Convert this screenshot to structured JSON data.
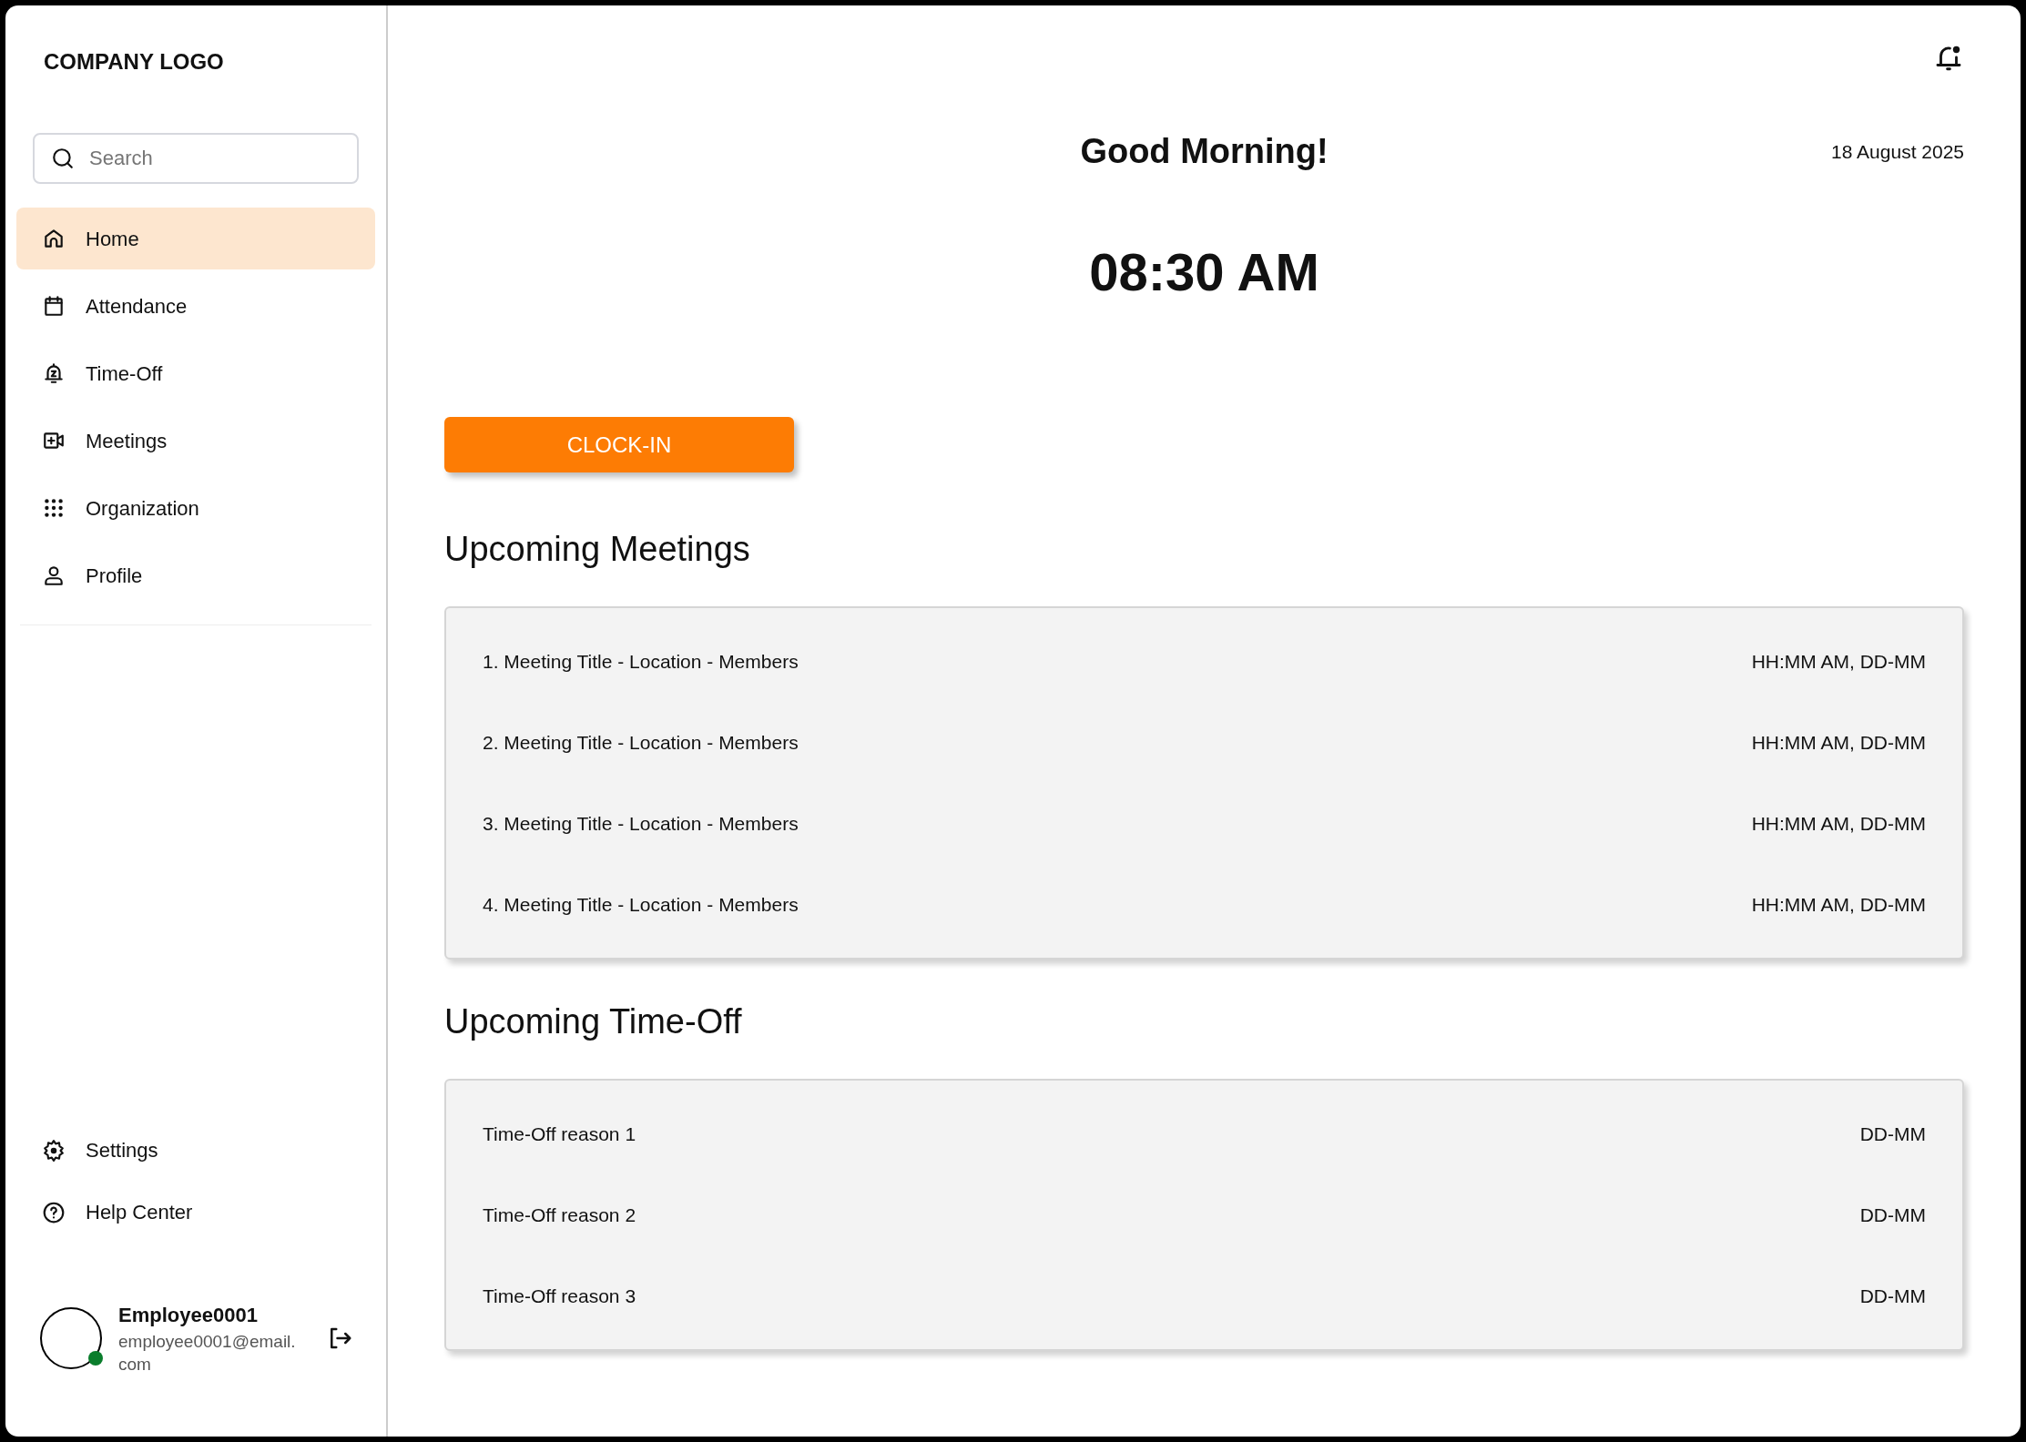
{
  "sidebar": {
    "logo": "COMPANY LOGO",
    "search": {
      "placeholder": "Search"
    },
    "nav": [
      {
        "label": "Home",
        "selected": true
      },
      {
        "label": "Attendance",
        "selected": false
      },
      {
        "label": "Time-Off",
        "selected": false
      },
      {
        "label": "Meetings",
        "selected": false
      },
      {
        "label": "Organization",
        "selected": false
      },
      {
        "label": "Profile",
        "selected": false
      }
    ],
    "footer_nav": [
      {
        "label": "Settings"
      },
      {
        "label": "Help Center"
      }
    ],
    "user": {
      "name": "Employee0001",
      "email": "employee0001@email.com",
      "online": true
    }
  },
  "header": {
    "greeting": "Good Morning!",
    "date": "18 August 2025",
    "time": "08:30 AM"
  },
  "clock_button": "CLOCK-IN",
  "meetings": {
    "title": "Upcoming Meetings",
    "items": [
      {
        "text": "1. Meeting Title - Location - Members",
        "when": "HH:MM AM, DD-MM"
      },
      {
        "text": "2. Meeting Title - Location - Members",
        "when": "HH:MM AM, DD-MM"
      },
      {
        "text": "3. Meeting Title - Location - Members",
        "when": "HH:MM AM, DD-MM"
      },
      {
        "text": "4. Meeting Title - Location - Members",
        "when": "HH:MM AM, DD-MM"
      }
    ]
  },
  "time_off": {
    "title": "Upcoming Time-Off",
    "items": [
      {
        "text": "Time-Off reason 1",
        "when": "DD-MM"
      },
      {
        "text": "Time-Off reason 2",
        "when": "DD-MM"
      },
      {
        "text": "Time-Off reason 3",
        "when": "DD-MM"
      }
    ]
  }
}
